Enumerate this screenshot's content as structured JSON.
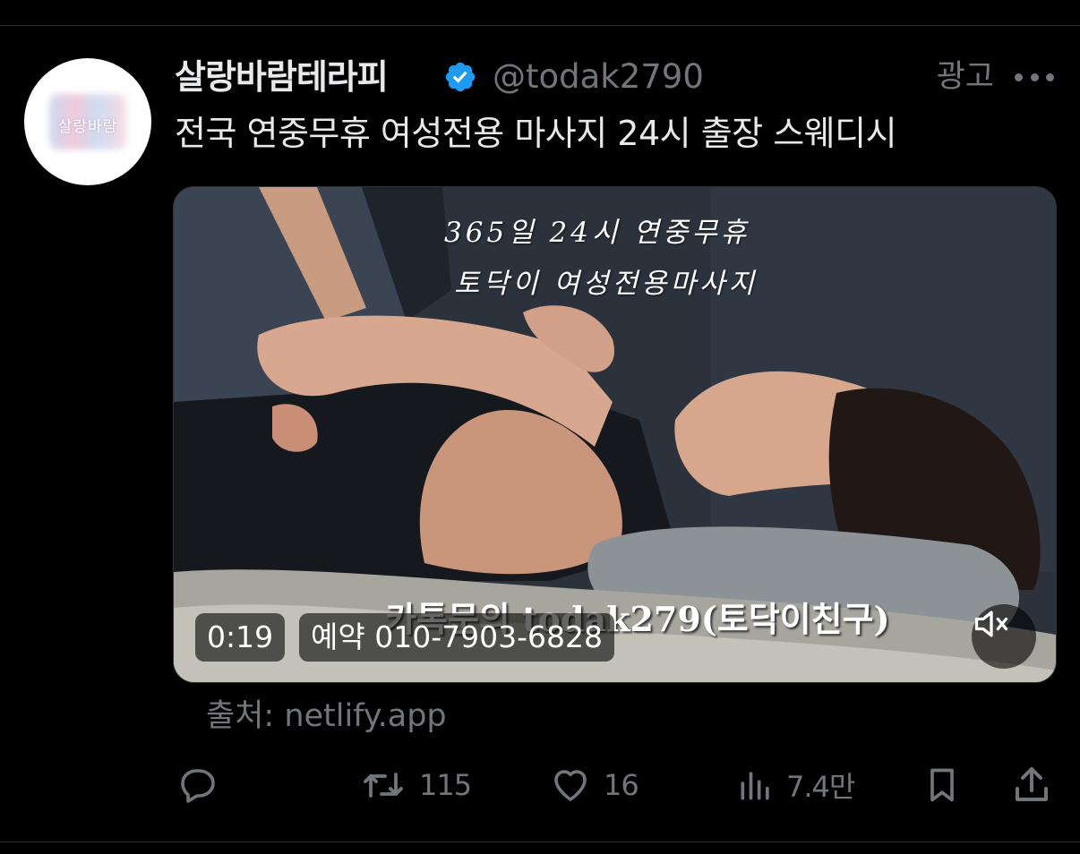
{
  "account": {
    "display_name": "살랑바람테라피",
    "handle": "@todak2790",
    "verified_icon": "verified-badge-icon",
    "avatar_text": "살랑바람"
  },
  "ad_label": "광고",
  "tweet_text": "전국 연중무휴 여성전용 마사지 24시 출장 스웨디시",
  "media": {
    "overlay_line1": "365일 24시 연중무휴",
    "overlay_line2": "토닥이 여성전용마사지",
    "overlay_kakao": "카톡문의 todak279(토닥이친구)",
    "time": "0:19",
    "phone": "예약 010-7903-6828"
  },
  "source": "출처: netlify.app",
  "actions": {
    "retweets": "115",
    "likes": "16",
    "views": "7.4만"
  },
  "colors": {
    "background": "#000000",
    "text": "#e7e9ea",
    "muted": "#71767b",
    "verified": "#1d9bf0"
  }
}
